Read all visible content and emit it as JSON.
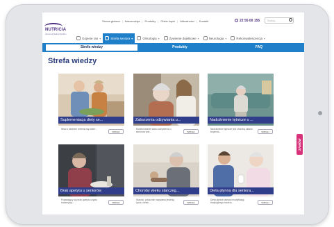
{
  "top_nav": {
    "items": [
      "Strona główna",
      "Nasza misja",
      "Produkty",
      "Gdzie kupić",
      "Aktualności",
      "Kontakt"
    ]
  },
  "phone": "22 55 00 155",
  "search": {
    "placeholder": "Szukaj..."
  },
  "logo": {
    "name": "NUTRICIA",
    "tagline": "Advanced Medical Nutrition"
  },
  "categories": [
    {
      "label": "Gojenie ran",
      "active": false
    },
    {
      "label": "Strefa seniora",
      "active": true
    },
    {
      "label": "Onkologia",
      "active": false
    },
    {
      "label": "Żywienie dojelitowe",
      "active": false
    },
    {
      "label": "Neurologia",
      "active": false
    },
    {
      "label": "Rekonwalescencja",
      "active": false
    }
  ],
  "tabs": [
    {
      "label": "Strefa wiedzy",
      "active": true
    },
    {
      "label": "Produkty",
      "active": false
    },
    {
      "label": "FAQ",
      "active": false
    }
  ],
  "page_title": "Strefa wiedzy",
  "cards": [
    {
      "title": "Suplementacja diety se...",
      "desc": "Wraz z wiekiem zmienia się wiele...",
      "more": "WIĘCEJ"
    },
    {
      "title": "Zaburzenia odżywiania u...",
      "desc": "Monitorowanie stanu odżywienia u seniorów jest...",
      "more": "WIĘCEJ"
    },
    {
      "title": "Nadciśnienie tętnicze u ...",
      "desc": "Nadciśnienie tętnicze jest chorobą układu krążenia...",
      "more": "WIĘCEJ"
    },
    {
      "title": "Brak apetytu u seniorów",
      "desc": "Pojawiający się brak apetytu często towarzyszy...",
      "more": "WIĘCEJ"
    },
    {
      "title": "Choroby wieku starczeg...",
      "desc": "Starość, potocznie nazywana jesienią życia, niesie...",
      "more": "WIĘCEJ"
    },
    {
      "title": "Dieta płynna dla seniora...",
      "desc": "Dieta płynna stanowi modyfikację tradycyjnego modelu...",
      "more": "WIĘCEJ"
    }
  ],
  "side_tab": "ZAMÓW",
  "colors": {
    "brand": "#4a2d80",
    "accent": "#1f7fc9",
    "caption": "#2f3d8a",
    "order": "#d6337a"
  }
}
